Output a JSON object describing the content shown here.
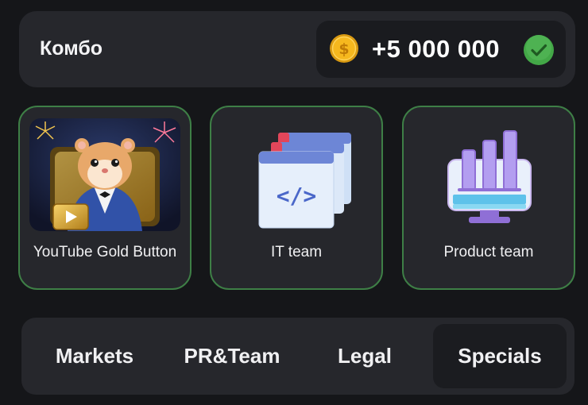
{
  "combo": {
    "title": "Комбо",
    "reward": "+5 000 000",
    "coin_icon": "dollar-coin-icon",
    "status_icon": "checkmark-icon"
  },
  "cards": [
    {
      "label": "YouTube Gold Button",
      "image": "hamster-gold-button-image"
    },
    {
      "label": "IT team",
      "image": "code-window-icon"
    },
    {
      "label": "Product team",
      "image": "bar-chart-monitor-icon"
    }
  ],
  "tabs": [
    {
      "label": "Markets"
    },
    {
      "label": "PR&Team"
    },
    {
      "label": "Legal"
    },
    {
      "label": "Specials",
      "selected": true
    }
  ],
  "colors": {
    "background": "#151619",
    "card": "#26272c",
    "card_border": "#3e7f46",
    "coin": "#f4b21a",
    "check": "#4caf4f"
  }
}
